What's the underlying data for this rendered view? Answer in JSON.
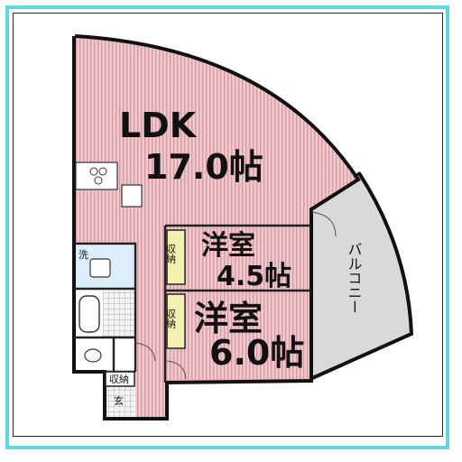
{
  "ldk": {
    "name": "LDK",
    "size": "17.0帖"
  },
  "bedroom1": {
    "name": "洋室",
    "size": "4.5帖"
  },
  "bedroom2": {
    "name": "洋室",
    "size": "6.0帖"
  },
  "balcony": {
    "name": "バルコニー"
  },
  "closet": {
    "label": "収納"
  },
  "washroom": {
    "label": "洗"
  },
  "entrance": {
    "label": "玄"
  },
  "colors": {
    "floor_pink": "#e8c4c8",
    "floor_stripe": "#d79ea6",
    "balcony_gray": "#d9d9d9",
    "frame_cyan": "#5fd6e0",
    "bath_blue": "#dbeefa"
  }
}
